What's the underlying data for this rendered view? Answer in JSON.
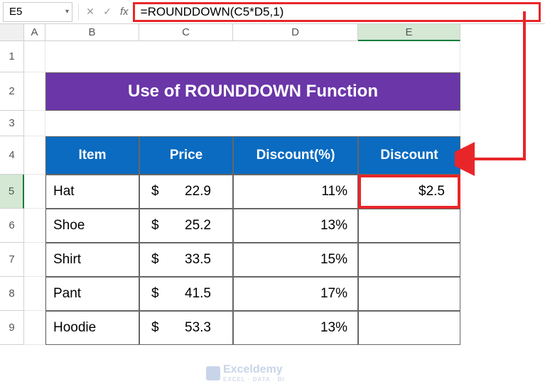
{
  "nameBox": "E5",
  "formula": "=ROUNDDOWN(C5*D5,1)",
  "colLabels": {
    "A": "A",
    "B": "B",
    "C": "C",
    "D": "D",
    "E": "E"
  },
  "rowLabels": [
    "1",
    "2",
    "3",
    "4",
    "5",
    "6",
    "7",
    "8",
    "9"
  ],
  "title": "Use of ROUNDDOWN Function",
  "headers": {
    "item": "Item",
    "price": "Price",
    "discountPct": "Discount(%)",
    "discount": "Discount"
  },
  "currency": "$",
  "rows": [
    {
      "item": "Hat",
      "price": "22.9",
      "pct": "11%",
      "disc": "$2.5"
    },
    {
      "item": "Shoe",
      "price": "25.2",
      "pct": "13%",
      "disc": ""
    },
    {
      "item": "Shirt",
      "price": "33.5",
      "pct": "15%",
      "disc": ""
    },
    {
      "item": "Pant",
      "price": "41.5",
      "pct": "17%",
      "disc": ""
    },
    {
      "item": "Hoodie",
      "price": "53.3",
      "pct": "13%",
      "disc": ""
    }
  ],
  "watermark": {
    "main": "Exceldemy",
    "sub": "EXCEL · DATA · BI"
  },
  "chart_data": {
    "type": "table",
    "title": "Use of ROUNDDOWN Function",
    "columns": [
      "Item",
      "Price",
      "Discount(%)",
      "Discount"
    ],
    "data": [
      [
        "Hat",
        22.9,
        0.11,
        2.5
      ],
      [
        "Shoe",
        25.2,
        0.13,
        null
      ],
      [
        "Shirt",
        33.5,
        0.15,
        null
      ],
      [
        "Pant",
        41.5,
        0.17,
        null
      ],
      [
        "Hoodie",
        53.3,
        0.13,
        null
      ]
    ],
    "formula_cell": "E5",
    "formula": "=ROUNDDOWN(C5*D5,1)"
  }
}
